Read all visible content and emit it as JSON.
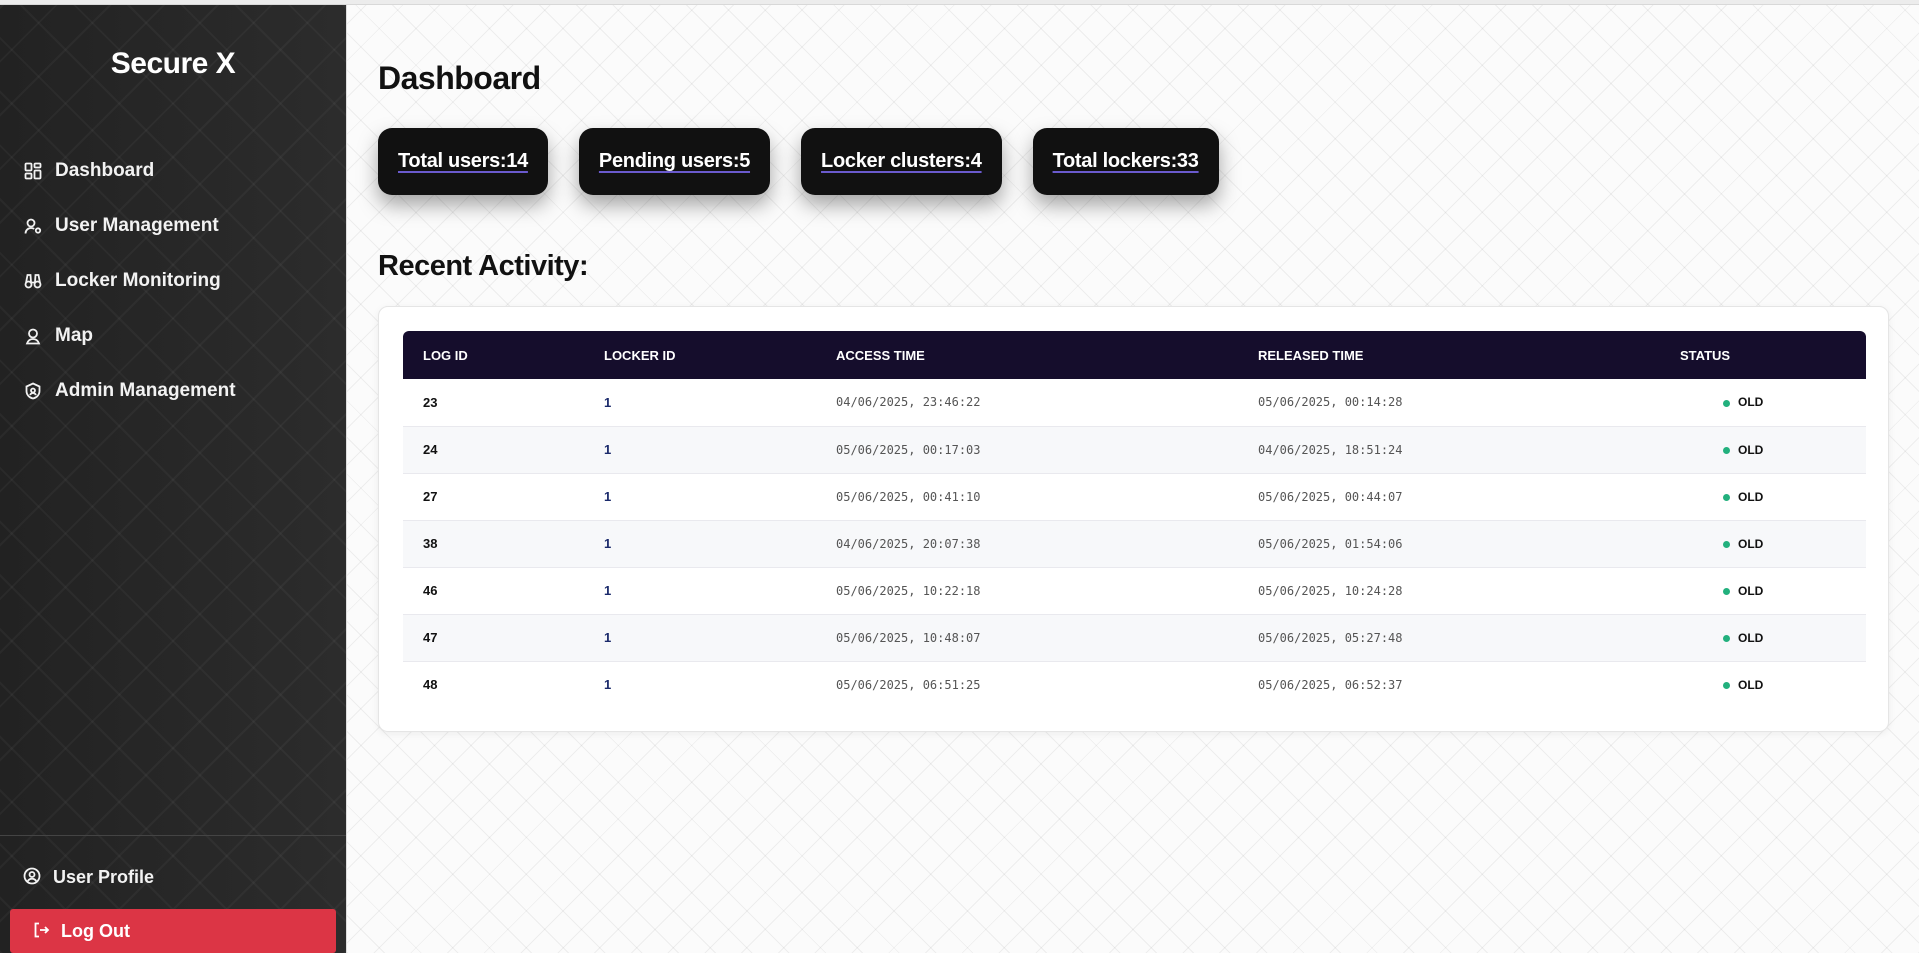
{
  "app": {
    "brand": "Secure X"
  },
  "sidebar": {
    "items": [
      {
        "label": "Dashboard",
        "icon": "dashboard-grid-icon"
      },
      {
        "label": "User Management",
        "icon": "user-gear-icon"
      },
      {
        "label": "Locker Monitoring",
        "icon": "binoculars-icon"
      },
      {
        "label": "Map",
        "icon": "map-user-icon"
      },
      {
        "label": "Admin Management",
        "icon": "shield-icon"
      }
    ],
    "profile_label": "User Profile",
    "logout_label": "Log Out"
  },
  "main": {
    "title": "Dashboard",
    "stats": [
      {
        "label": "Total users:14"
      },
      {
        "label": "Pending users:5"
      },
      {
        "label": "Locker clusters:4"
      },
      {
        "label": "Total lockers:33"
      }
    ],
    "activity_title": "Recent Activity:",
    "table": {
      "headers": [
        "LOG ID",
        "LOCKER ID",
        "ACCESS TIME",
        "RELEASED TIME",
        "STATUS"
      ],
      "rows": [
        {
          "log_id": "23",
          "locker_id": "1",
          "access": "04/06/2025, 23:46:22",
          "released": "05/06/2025, 00:14:28",
          "status": "OLD"
        },
        {
          "log_id": "24",
          "locker_id": "1",
          "access": "05/06/2025, 00:17:03",
          "released": "04/06/2025, 18:51:24",
          "status": "OLD"
        },
        {
          "log_id": "27",
          "locker_id": "1",
          "access": "05/06/2025, 00:41:10",
          "released": "05/06/2025, 00:44:07",
          "status": "OLD"
        },
        {
          "log_id": "38",
          "locker_id": "1",
          "access": "04/06/2025, 20:07:38",
          "released": "05/06/2025, 01:54:06",
          "status": "OLD"
        },
        {
          "log_id": "46",
          "locker_id": "1",
          "access": "05/06/2025, 10:22:18",
          "released": "05/06/2025, 10:24:28",
          "status": "OLD"
        },
        {
          "log_id": "47",
          "locker_id": "1",
          "access": "05/06/2025, 10:48:07",
          "released": "05/06/2025, 05:27:48",
          "status": "OLD"
        },
        {
          "log_id": "48",
          "locker_id": "1",
          "access": "05/06/2025, 06:51:25",
          "released": "05/06/2025, 06:52:37",
          "status": "OLD"
        }
      ]
    }
  },
  "colors": {
    "sidebar_bg": "#262626",
    "logout_bg": "#dc3545",
    "table_header_bg": "#150d2c",
    "stat_bg": "#111111",
    "status_dot": "#22b07d"
  }
}
